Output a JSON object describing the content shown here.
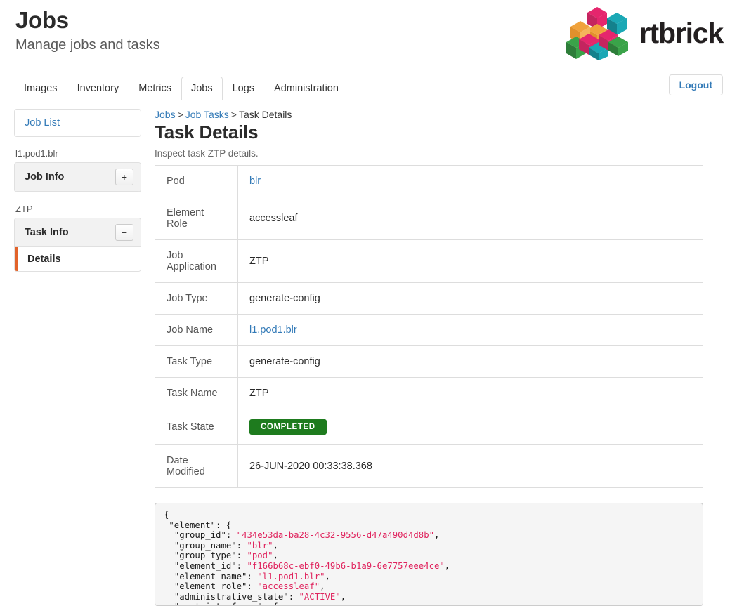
{
  "header": {
    "title": "Jobs",
    "subtitle": "Manage jobs and tasks",
    "brand_name": "rtbrick",
    "brand_colors": {
      "pink": "#e5266d",
      "teal": "#1ba8b5",
      "green": "#3aa349",
      "orange": "#f0a23c",
      "dark_pink": "#c4245f",
      "dark_teal": "#14818c",
      "dark_green": "#2d7d39",
      "text": "#231f20"
    }
  },
  "tabs": {
    "items": [
      {
        "label": "Images",
        "active": false
      },
      {
        "label": "Inventory",
        "active": false
      },
      {
        "label": "Metrics",
        "active": false
      },
      {
        "label": "Jobs",
        "active": true
      },
      {
        "label": "Logs",
        "active": false
      },
      {
        "label": "Administration",
        "active": false
      }
    ],
    "logout_label": "Logout"
  },
  "sidebar": {
    "job_list_label": "Job List",
    "job_group_label": "l1.pod1.blr",
    "job_info_label": "Job Info",
    "job_info_toggle": "+",
    "task_group_label": "ZTP",
    "task_info_label": "Task Info",
    "task_info_toggle": "−",
    "details_label": "Details",
    "accent_color": "#e2632a"
  },
  "breadcrumb": {
    "items": [
      {
        "label": "Jobs",
        "link": true
      },
      {
        "label": "Job Tasks",
        "link": true
      },
      {
        "label": "Task Details",
        "link": false
      }
    ],
    "separator": ">"
  },
  "main": {
    "title": "Task Details",
    "subtitle": "Inspect task ZTP details.",
    "rows": [
      {
        "key": "Pod",
        "value": "blr",
        "type": "link"
      },
      {
        "key": "Element Role",
        "value": "accessleaf",
        "type": "text"
      },
      {
        "key": "Job Application",
        "value": "ZTP",
        "type": "text"
      },
      {
        "key": "Job Type",
        "value": "generate-config",
        "type": "text"
      },
      {
        "key": "Job Name",
        "value": "l1.pod1.blr",
        "type": "link"
      },
      {
        "key": "Task Type",
        "value": "generate-config",
        "type": "text"
      },
      {
        "key": "Task Name",
        "value": "ZTP",
        "type": "text"
      },
      {
        "key": "Task State",
        "value": "COMPLETED",
        "type": "badge"
      },
      {
        "key": "Date Modified",
        "value": "26-JUN-2020 00:33:38.368",
        "type": "text"
      }
    ],
    "badge_color": "#1e7b1e"
  },
  "code": {
    "lines": [
      {
        "indent": 0,
        "key": null,
        "value": null,
        "open": "{"
      },
      {
        "indent": 1,
        "key": "\"element\"",
        "value": null,
        "open": "{"
      },
      {
        "indent": 2,
        "key": "\"group_id\"",
        "value": "\"434e53da-ba28-4c32-9556-d47a490d4d8b\"",
        "comma": true
      },
      {
        "indent": 2,
        "key": "\"group_name\"",
        "value": "\"blr\"",
        "comma": true
      },
      {
        "indent": 2,
        "key": "\"group_type\"",
        "value": "\"pod\"",
        "comma": true
      },
      {
        "indent": 2,
        "key": "\"element_id\"",
        "value": "\"f166b68c-ebf0-49b6-b1a9-6e7757eee4ce\"",
        "comma": true
      },
      {
        "indent": 2,
        "key": "\"element_name\"",
        "value": "\"l1.pod1.blr\"",
        "comma": true
      },
      {
        "indent": 2,
        "key": "\"element_role\"",
        "value": "\"accessleaf\"",
        "comma": true
      },
      {
        "indent": 2,
        "key": "\"administrative_state\"",
        "value": "\"ACTIVE\"",
        "comma": true
      },
      {
        "indent": 2,
        "key": "\"mgmt_interfaces\"",
        "value": null,
        "open": "{"
      }
    ],
    "string_color": "#e0245e"
  }
}
